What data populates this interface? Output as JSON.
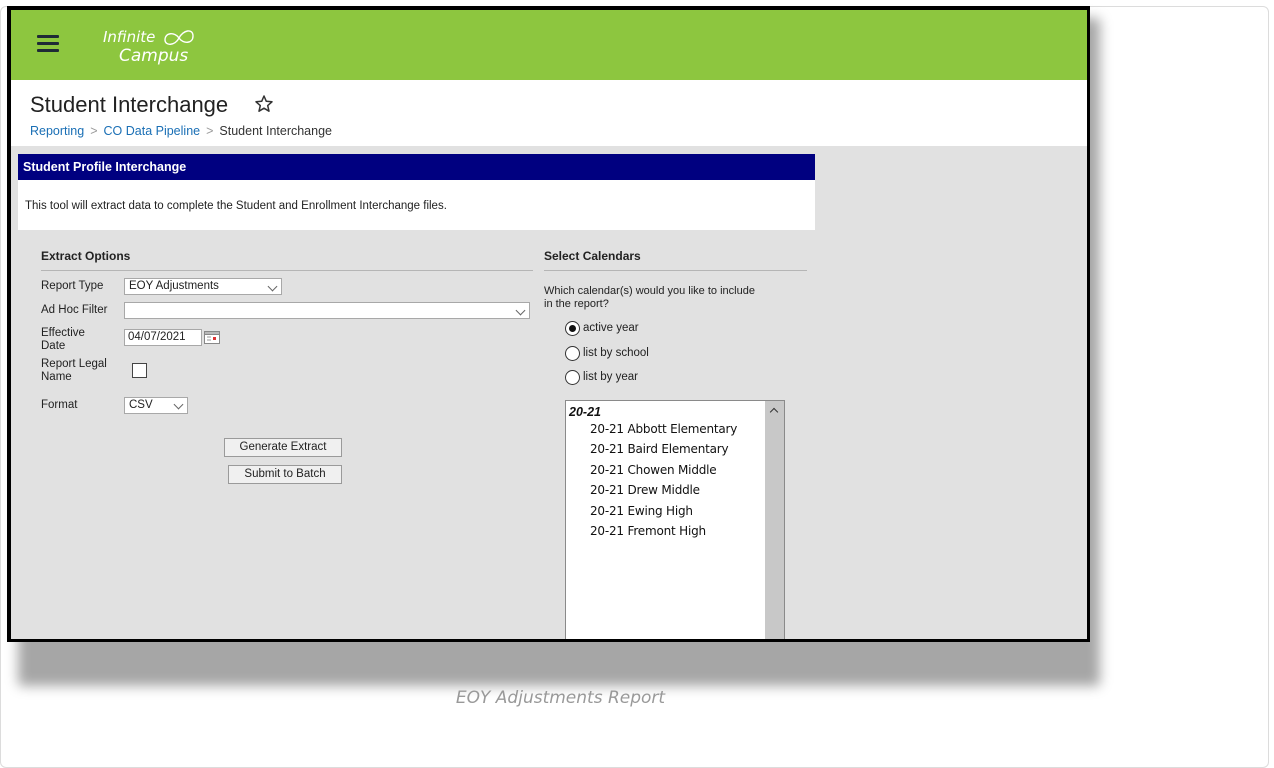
{
  "app": {
    "logo_line1": "Infinite",
    "logo_line2": "Campus",
    "page_title": "Student Interchange"
  },
  "breadcrumb": {
    "items": [
      "Reporting",
      "CO Data Pipeline"
    ],
    "current": "Student Interchange"
  },
  "panel": {
    "header": "Student Profile Interchange",
    "description": "This tool will extract data to complete the Student and Enrollment Interchange files."
  },
  "extract_options": {
    "heading": "Extract Options",
    "report_type_label": "Report Type",
    "report_type_value": "EOY Adjustments",
    "ad_hoc_filter_label": "Ad Hoc Filter",
    "ad_hoc_filter_value": "",
    "effective_date_label_1": "Effective",
    "effective_date_label_2": "Date",
    "effective_date_value": "04/07/2021",
    "report_legal_name_label_1": "Report Legal",
    "report_legal_name_label_2": "Name",
    "report_legal_name_checked": false,
    "format_label": "Format",
    "format_value": "CSV",
    "generate_button": "Generate Extract",
    "batch_button": "Submit to Batch"
  },
  "select_calendars": {
    "heading": "Select Calendars",
    "prompt_1": "Which calendar(s) would you like to include",
    "prompt_2": "in the report?",
    "radio_options": [
      {
        "label": "active year",
        "selected": true
      },
      {
        "label": "list by school",
        "selected": false
      },
      {
        "label": "list by year",
        "selected": false
      }
    ],
    "group_label": "20-21",
    "calendars": [
      "20-21 Abbott Elementary",
      "20-21 Baird Elementary",
      "20-21 Chowen Middle",
      "20-21 Drew Middle",
      "20-21 Ewing High",
      "20-21 Fremont High"
    ]
  },
  "caption": "EOY Adjustments Report",
  "colors": {
    "topbar": "#8dc63f",
    "panel_header": "#000080",
    "link": "#1a6fb5"
  }
}
